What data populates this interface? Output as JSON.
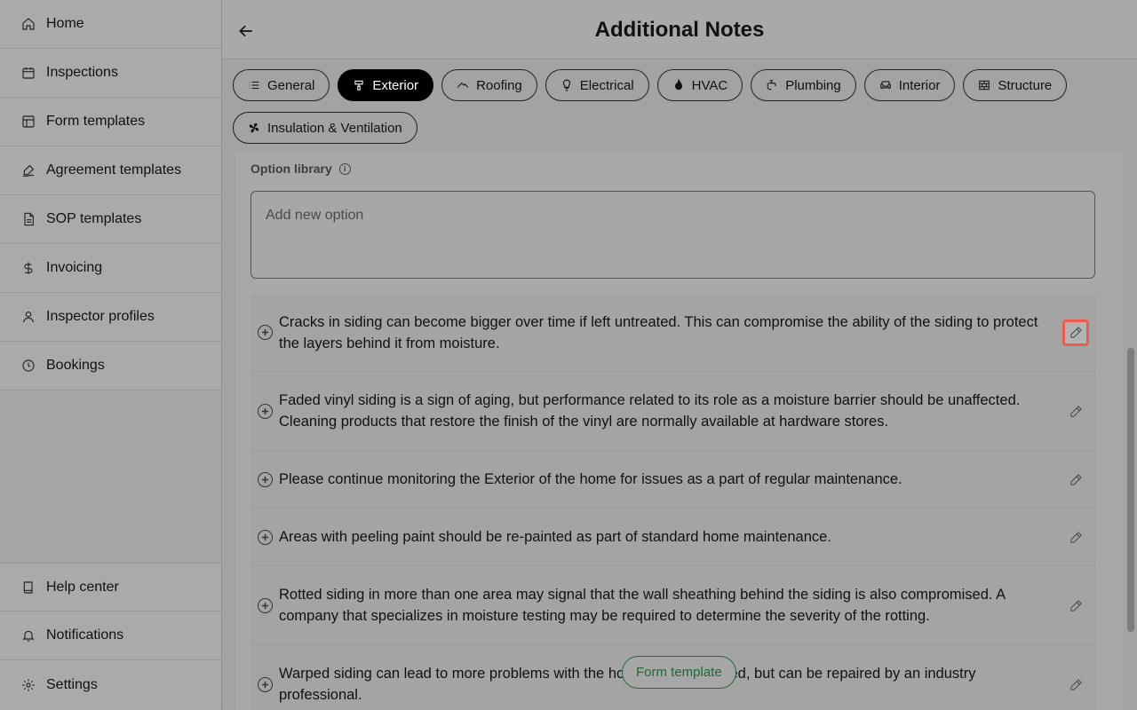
{
  "sidebar": {
    "top_items": [
      {
        "label": "Home",
        "icon": "home-icon"
      },
      {
        "label": "Inspections",
        "icon": "calendar-icon"
      },
      {
        "label": "Form templates",
        "icon": "layout-icon"
      },
      {
        "label": "Agreement templates",
        "icon": "signature-icon"
      },
      {
        "label": "SOP templates",
        "icon": "document-icon"
      },
      {
        "label": "Invoicing",
        "icon": "dollar-icon"
      },
      {
        "label": "Inspector profiles",
        "icon": "user-icon"
      },
      {
        "label": "Bookings",
        "icon": "clock-icon"
      }
    ],
    "bottom_items": [
      {
        "label": "Help center",
        "icon": "book-icon"
      },
      {
        "label": "Notifications",
        "icon": "bell-icon"
      },
      {
        "label": "Settings",
        "icon": "gear-icon"
      }
    ]
  },
  "header": {
    "title": "Additional Notes"
  },
  "tabs": [
    {
      "label": "General",
      "icon": "list-icon",
      "active": false
    },
    {
      "label": "Exterior",
      "icon": "paint-brush-icon",
      "active": true
    },
    {
      "label": "Roofing",
      "icon": "roof-icon",
      "active": false
    },
    {
      "label": "Electrical",
      "icon": "lightbulb-icon",
      "active": false
    },
    {
      "label": "HVAC",
      "icon": "flame-icon",
      "active": false
    },
    {
      "label": "Plumbing",
      "icon": "faucet-icon",
      "active": false
    },
    {
      "label": "Interior",
      "icon": "sofa-icon",
      "active": false
    },
    {
      "label": "Structure",
      "icon": "brick-wall-icon",
      "active": false
    },
    {
      "label": "Insulation & Ventilation",
      "icon": "fan-icon",
      "active": false
    }
  ],
  "library": {
    "label": "Option library",
    "new_option_placeholder": "Add new option"
  },
  "options": [
    {
      "text": "Cracks in siding can become bigger over time if left untreated. This can compromise the ability of the siding to protect the layers behind it from moisture."
    },
    {
      "text": "Faded vinyl siding is a sign of aging, but performance related to its role as a moisture barrier should be unaffected. Cleaning products that restore the finish of the vinyl are normally available at hardware stores."
    },
    {
      "text": "Please continue monitoring the Exterior of the home for issues as a part of regular maintenance."
    },
    {
      "text": "Areas with peeling paint should be re-painted as part of standard home maintenance."
    },
    {
      "text": "Rotted siding in more than one area may signal that the wall sheathing behind the siding is also compromised. A company that specializes in moisture testing may be required to determine the severity of the rotting."
    },
    {
      "text": "Warped siding can lead to more problems with the home if left untreated, but can be repaired by an industry professional."
    }
  ],
  "floating_button": {
    "label": "Form template"
  },
  "colors": {
    "focus_ring": "#ef5a4f",
    "pill_green": "#1e6a35"
  }
}
